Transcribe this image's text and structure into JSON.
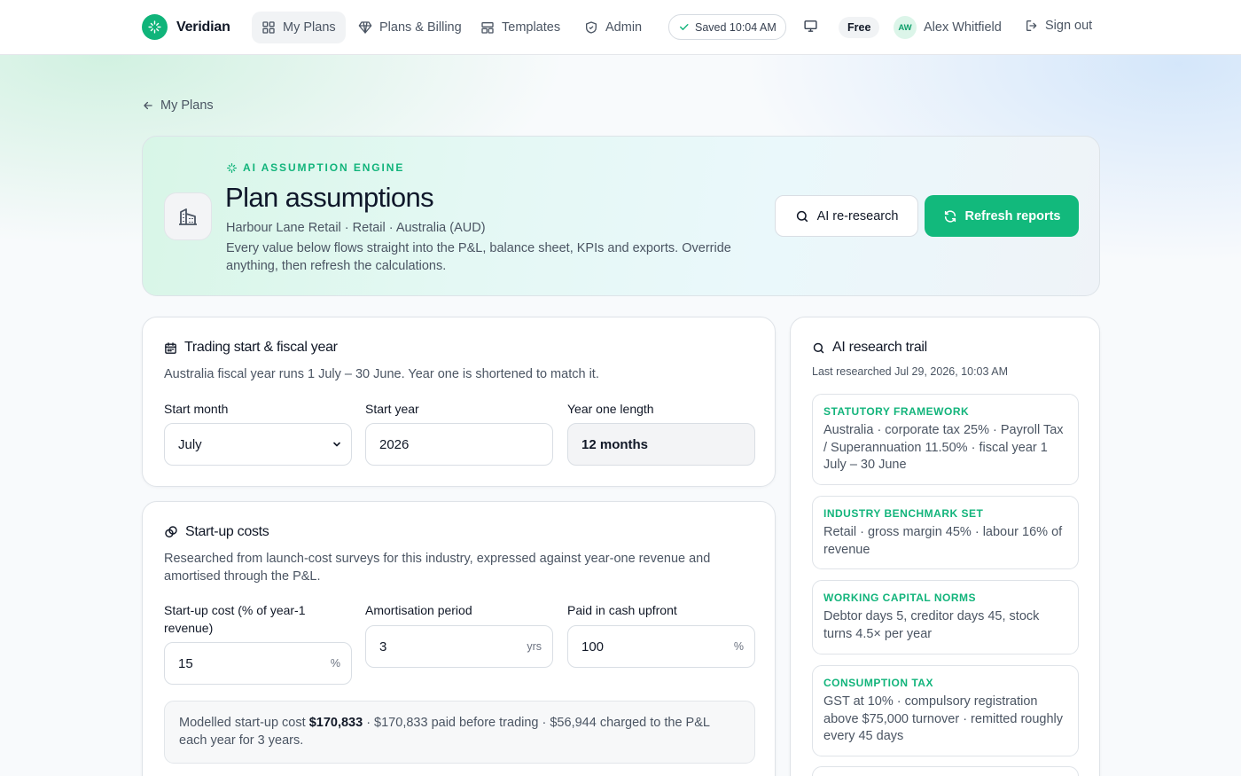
{
  "brand": {
    "name": "Veridian"
  },
  "nav": {
    "items": [
      {
        "label": "My Plans",
        "icon": "grid-icon",
        "active": true
      },
      {
        "label": "Plans & Billing",
        "icon": "diamond-icon",
        "active": false
      },
      {
        "label": "Templates",
        "icon": "template-icon",
        "active": false
      },
      {
        "label": "Admin",
        "icon": "shield-icon",
        "active": false
      }
    ],
    "saved_status": "Saved 10:04 AM",
    "plan_badge": "Free",
    "user": {
      "initials": "AW",
      "name": "Alex Whitfield"
    },
    "sign_out": "Sign out"
  },
  "back_link": "My Plans",
  "hero": {
    "eyebrow": "AI ASSUMPTION ENGINE",
    "title": "Plan assumptions",
    "subtitle": "Harbour Lane Retail · Retail · Australia (AUD)",
    "description": "Every value below flows straight into the P&L, balance sheet, KPIs and exports. Override anything, then refresh the calculations.",
    "btn_research": "AI re-research",
    "btn_refresh": "Refresh reports"
  },
  "trading": {
    "title": "Trading start & fiscal year",
    "description": "Australia fiscal year runs 1 July – 30 June. Year one is shortened to match it.",
    "start_month_label": "Start month",
    "start_month_value": "July",
    "start_year_label": "Start year",
    "start_year_value": "2026",
    "year_one_label": "Year one length",
    "year_one_value": "12 months"
  },
  "startup": {
    "title": "Start-up costs",
    "description": "Researched from launch-cost surveys for this industry, expressed against year-one revenue and amortised through the P&L.",
    "cost_label": "Start-up cost (% of year-1 revenue)",
    "cost_value": "15",
    "cost_suffix": "%",
    "amort_label": "Amortisation period",
    "amort_value": "3",
    "amort_suffix": "yrs",
    "cash_label": "Paid in cash upfront",
    "cash_value": "100",
    "cash_suffix": "%",
    "summary_prefix": "Modelled start-up cost ",
    "summary_amount": "$170,833",
    "summary_rest": " · $170,833 paid before trading · $56,944 charged to the P&L each year for 3 years."
  },
  "trail": {
    "title": "AI research trail",
    "subtitle": "Last researched Jul 29, 2026, 10:03 AM",
    "items": [
      {
        "heading": "STATUTORY FRAMEWORK",
        "body": "Australia · corporate tax 25% · Payroll Tax / Superannuation 11.50% · fiscal year 1 July – 30 June"
      },
      {
        "heading": "INDUSTRY BENCHMARK SET",
        "body": "Retail · gross margin 45% · labour 16% of revenue"
      },
      {
        "heading": "WORKING CAPITAL NORMS",
        "body": "Debtor days 5, creditor days 45, stock turns 4.5× per year"
      },
      {
        "heading": "CONSUMPTION TAX",
        "body": "GST at 10% · compulsory registration above $75,000 turnover · remitted roughly every 45 days"
      }
    ]
  },
  "colors": {
    "accent": "#12b97c",
    "accent_text": "#12b47b"
  }
}
